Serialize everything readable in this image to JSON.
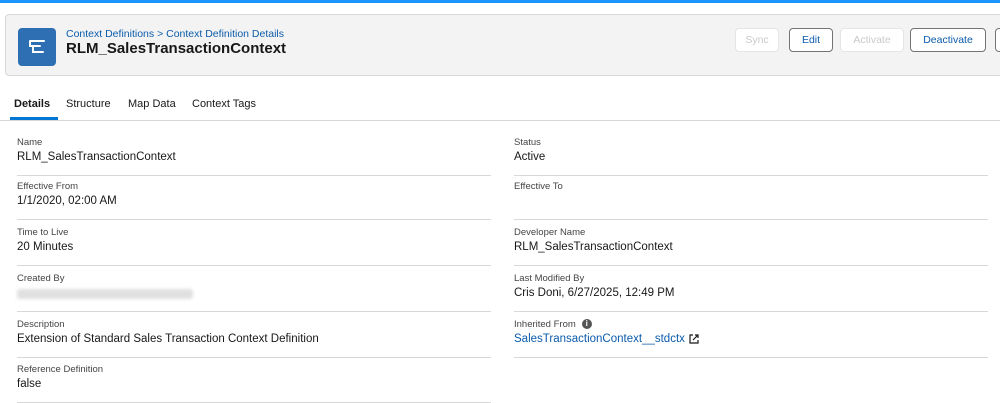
{
  "header": {
    "breadcrumb": {
      "parent": "Context Definitions",
      "separator": ">",
      "current": "Context Definition Details"
    },
    "title": "RLM_SalesTransactionContext",
    "record_icon": "hierarchy-icon",
    "actions": {
      "sync": "Sync",
      "edit": "Edit",
      "activate": "Activate",
      "deactivate": "Deactivate"
    }
  },
  "tabs": [
    {
      "label": "Details",
      "active": true
    },
    {
      "label": "Structure"
    },
    {
      "label": "Map Data"
    },
    {
      "label": "Context Tags"
    }
  ],
  "fields": {
    "name": {
      "label": "Name",
      "value": "RLM_SalesTransactionContext"
    },
    "status": {
      "label": "Status",
      "value": "Active"
    },
    "effective_from": {
      "label": "Effective From",
      "value": "1/1/2020, 02:00 AM"
    },
    "effective_to": {
      "label": "Effective To",
      "value": ""
    },
    "time_to_live": {
      "label": "Time to Live",
      "value": "20 Minutes"
    },
    "developer_name": {
      "label": "Developer Name",
      "value": "RLM_SalesTransactionContext"
    },
    "created_by": {
      "label": "Created By",
      "value": ""
    },
    "last_modified_by": {
      "label": "Last Modified By",
      "value": "Cris Doni, 6/27/2025, 12:49 PM"
    },
    "description": {
      "label": "Description",
      "value": "Extension of Standard Sales Transaction Context Definition"
    },
    "inherited_from": {
      "label": "Inherited From",
      "value": "SalesTransactionContext__stdctx"
    },
    "reference_definition": {
      "label": "Reference Definition",
      "value": "false"
    }
  },
  "colors": {
    "accent": "#0176d3",
    "link": "#0b5cab",
    "icon_bg": "#2e6fb4"
  }
}
